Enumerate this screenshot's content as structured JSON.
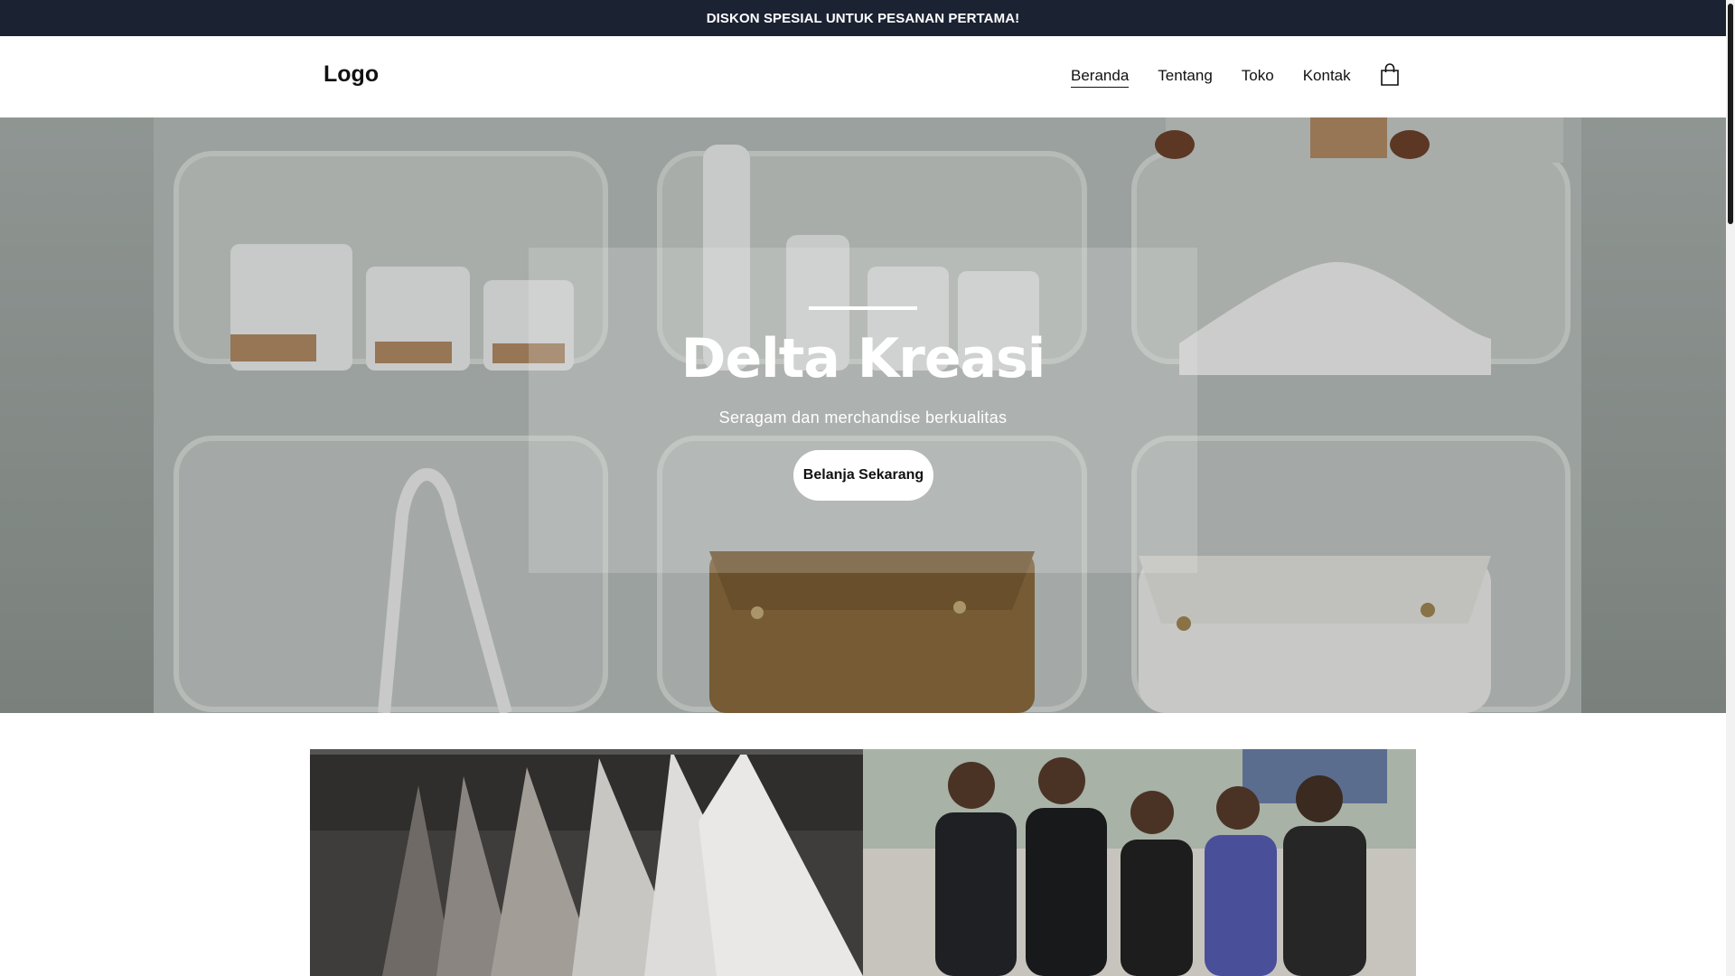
{
  "announcement": {
    "text": "DISKON SPESIAL UNTUK PESANAN PERTAMA!"
  },
  "header": {
    "logo": "Logo",
    "nav": [
      {
        "label": "Beranda",
        "active": true
      },
      {
        "label": "Tentang",
        "active": false
      },
      {
        "label": "Toko",
        "active": false
      },
      {
        "label": "Kontak",
        "active": false
      }
    ],
    "cart_icon": "shopping-bag-icon"
  },
  "hero": {
    "title": "Delta Kreasi",
    "subtitle": "Seragam dan merchandise berkualitas",
    "cta_label": "Belanja Sekarang"
  },
  "colors": {
    "announcement_bg": "#1b2232",
    "text": "#111111",
    "button_bg": "#ffffff"
  }
}
